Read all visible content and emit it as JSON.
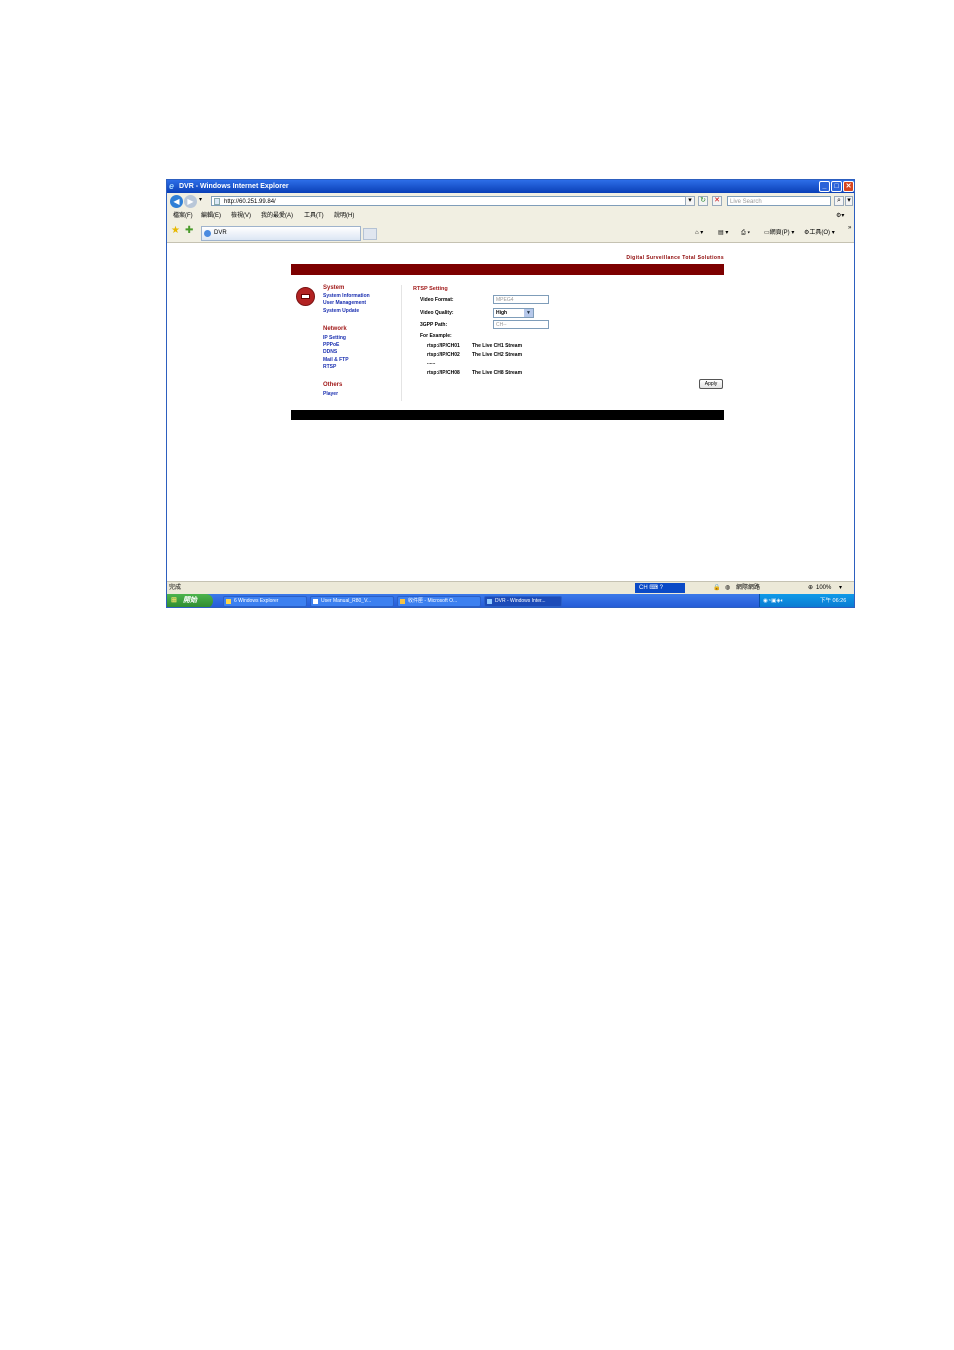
{
  "window": {
    "title": "DVR - Windows Internet Explorer",
    "controls": {
      "minimize": "_",
      "maximize": "□",
      "close": "✕"
    }
  },
  "address_bar": {
    "url": "http://60.251.99.84/",
    "search_placeholder": "Live Search"
  },
  "menu": [
    "檔案(F)",
    "編輯(E)",
    "檢視(V)",
    "我的最愛(A)",
    "工具(T)",
    "說明(H)"
  ],
  "tab": {
    "label": "DVR"
  },
  "toolbar": {
    "page": "網頁(P)",
    "tools": "工具(O)",
    "chevron": "»"
  },
  "page": {
    "tagline": "Digital Surveillance Total Solutions",
    "sidebar": {
      "system": {
        "title": "System",
        "items": [
          "System Information",
          "User Management",
          "System Update"
        ]
      },
      "network": {
        "title": "Network",
        "items": [
          "IP Setting",
          "PPPoE",
          "DDNS",
          "Mail & FTP",
          "RTSP"
        ]
      },
      "others": {
        "title": "Others",
        "items": [
          "Player"
        ]
      }
    },
    "rtsp": {
      "title": "RTSP Setting",
      "video_format_label": "Video Format:",
      "video_format_value": "MPEG4",
      "video_quality_label": "Video Quality:",
      "video_quality_value": "High",
      "path_label": "3GPP Path:",
      "path_placeholder": "CH--",
      "example_label": "For Example:",
      "examples": [
        {
          "path": "rtsp://IP/CH01",
          "desc": "The Live CH1 Stream"
        },
        {
          "path": "rtsp://IP/CH02",
          "desc": "The Live CH2 Stream"
        },
        {
          "path": "......",
          "desc": ""
        },
        {
          "path": "rtsp://IP/CH08",
          "desc": "The Live CH8 Stream"
        }
      ],
      "apply_label": "Apply"
    }
  },
  "status_bar": {
    "status": "完成",
    "language": "CH",
    "zone": "網際網路",
    "zoom": "100%"
  },
  "taskbar": {
    "start": "開始",
    "tasks": [
      "6 Windows Explorer",
      "User Manual_R80_V...",
      "收件匣 - Microsoft O...",
      "DVR - Windows Inter..."
    ],
    "clock": "下午 06:26"
  },
  "colors": {
    "brand_red": "#7d0000",
    "link_blue": "#1a2fb0",
    "xp_blue": "#245ad6"
  }
}
